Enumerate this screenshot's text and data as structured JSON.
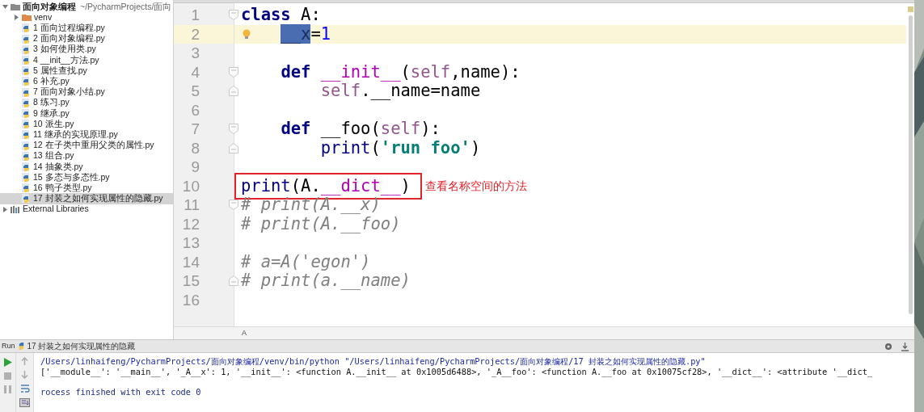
{
  "project_tree": [
    {
      "kind": "project",
      "label": "面向对象编程",
      "path": "~/PycharmProjects/面向",
      "expanded": true,
      "selected": false,
      "children": [
        {
          "kind": "folder",
          "label": "venv",
          "expanded": false,
          "selected": false
        },
        {
          "kind": "file",
          "label": "1 面向过程编程.py",
          "selected": false
        },
        {
          "kind": "file",
          "label": "2 面向对象编程.py",
          "selected": false
        },
        {
          "kind": "file",
          "label": "3 如何使用类.py",
          "selected": false
        },
        {
          "kind": "file",
          "label": "4 __init__方法.py",
          "selected": false
        },
        {
          "kind": "file",
          "label": "5 属性查找.py",
          "selected": false
        },
        {
          "kind": "file",
          "label": "6 补充.py",
          "selected": false
        },
        {
          "kind": "file",
          "label": "7 面向对象小结.py",
          "selected": false
        },
        {
          "kind": "file",
          "label": "8 练习.py",
          "selected": false
        },
        {
          "kind": "file",
          "label": "9 继承.py",
          "selected": false
        },
        {
          "kind": "file",
          "label": "10 派生.py",
          "selected": false
        },
        {
          "kind": "file",
          "label": "11 继承的实现原理.py",
          "selected": false
        },
        {
          "kind": "file",
          "label": "12 在子类中重用父类的属性.py",
          "selected": false
        },
        {
          "kind": "file",
          "label": "13 组合.py",
          "selected": false
        },
        {
          "kind": "file",
          "label": "14 抽象类.py",
          "selected": false
        },
        {
          "kind": "file",
          "label": "15 多态与多态性.py",
          "selected": false
        },
        {
          "kind": "file",
          "label": "16 鸭子类型.py",
          "selected": false
        },
        {
          "kind": "file",
          "label": "17 封装之如何实现属性的隐藏.py",
          "selected": true
        }
      ]
    },
    {
      "kind": "library",
      "label": "External Libraries",
      "expanded": false,
      "selected": false
    }
  ],
  "editor": {
    "lines": [
      {
        "number": "1",
        "current": false,
        "fold_start": true,
        "tokens": [
          {
            "kind": "keyword",
            "text": "class"
          },
          {
            "kind": "plain",
            "text": " A:"
          }
        ]
      },
      {
        "number": "2",
        "current": true,
        "bulb": true,
        "tokens": [
          {
            "kind": "selected",
            "text": "    __x"
          },
          {
            "kind": "plain",
            "text": "="
          },
          {
            "kind": "number",
            "text": "1"
          }
        ]
      },
      {
        "number": "3",
        "current": false
      },
      {
        "number": "4",
        "current": false,
        "fold_start": true,
        "tokens": [
          {
            "kind": "keyword",
            "text": "    def"
          },
          {
            "kind": "magic",
            "text": " __init__"
          },
          {
            "kind": "plain",
            "text": "("
          },
          {
            "kind": "self",
            "text": "self"
          },
          {
            "kind": "plain",
            "text": ",name):"
          }
        ]
      },
      {
        "number": "5",
        "current": false,
        "fold_end": true,
        "tokens": [
          {
            "kind": "self",
            "text": "        self"
          },
          {
            "kind": "plain",
            "text": ".__name=name"
          }
        ]
      },
      {
        "number": "6",
        "current": false
      },
      {
        "number": "7",
        "current": false,
        "fold_start": true,
        "tokens": [
          {
            "kind": "keyword",
            "text": "    def"
          },
          {
            "kind": "plain",
            "text": " __foo("
          },
          {
            "kind": "self",
            "text": "self"
          },
          {
            "kind": "plain",
            "text": "):"
          }
        ]
      },
      {
        "number": "8",
        "current": false,
        "fold_end": true,
        "tokens": [
          {
            "kind": "builtin",
            "text": "        print"
          },
          {
            "kind": "plain",
            "text": "("
          },
          {
            "kind": "string",
            "text": "'run foo'"
          },
          {
            "kind": "plain",
            "text": ")"
          }
        ]
      },
      {
        "number": "9",
        "current": false
      },
      {
        "number": "10",
        "current": false,
        "boxed": true,
        "note": "查看名称空间的方法",
        "tokens": [
          {
            "kind": "builtin",
            "text": "print"
          },
          {
            "kind": "plain",
            "text": "(A."
          },
          {
            "kind": "magic",
            "text": "__dict__"
          },
          {
            "kind": "plain",
            "text": ")"
          }
        ]
      },
      {
        "number": "11",
        "current": false,
        "fold_start": true,
        "tokens": [
          {
            "kind": "comment",
            "text": "# print(A.__x)"
          }
        ]
      },
      {
        "number": "12",
        "current": false,
        "tokens": [
          {
            "kind": "comment",
            "text": "# print(A.__foo)"
          }
        ]
      },
      {
        "number": "13",
        "current": false
      },
      {
        "number": "14",
        "current": false,
        "tokens": [
          {
            "kind": "comment",
            "text": "# a=A('egon')"
          }
        ]
      },
      {
        "number": "15",
        "current": false,
        "fold_end": true,
        "tokens": [
          {
            "kind": "comment",
            "text": "# print(a.__name)"
          }
        ]
      },
      {
        "number": "16",
        "current": false
      }
    ],
    "breadcrumb": "A"
  },
  "run_panel": {
    "title": "Run",
    "config": "17 封装之如何实现属性的隐藏",
    "console": [
      {
        "kind": "command",
        "text": "/Users/linhaifeng/PycharmProjects/面向对象编程/venv/bin/python \"/Users/linhaifeng/PycharmProjects/面向对象编程/17 封装之如何实现属性的隐藏.py\""
      },
      {
        "kind": "output",
        "text": "['__module__': '__main__', '_A__x': 1, '__init__': <function A.__init__ at 0x1005d6488>, '_A__foo': <function A.__foo at 0x10075cf28>, '__dict__': <attribute '__dict_"
      },
      {
        "kind": "exit",
        "text": "rocess finished with exit code 0"
      }
    ]
  }
}
